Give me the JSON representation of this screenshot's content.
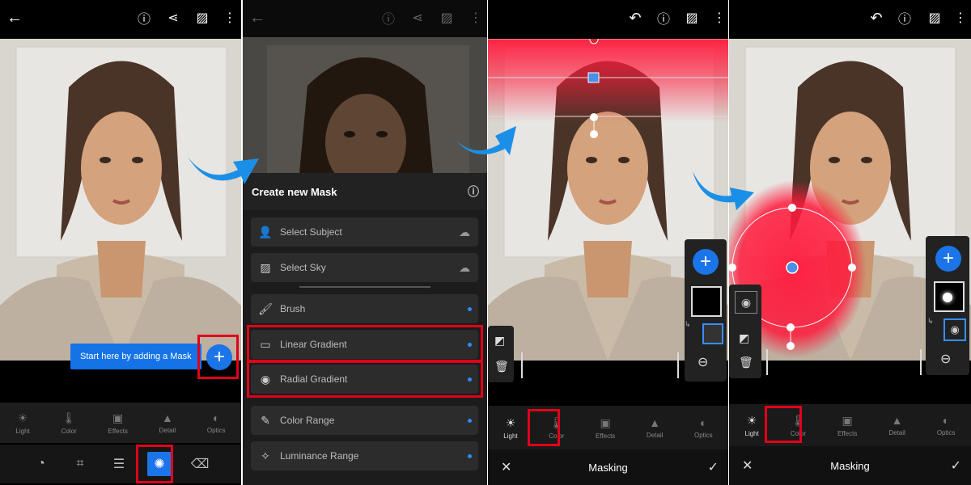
{
  "panel1": {
    "tooltip": "Start here by adding a Mask",
    "tools": [
      {
        "label": "Light",
        "glyph": "☀"
      },
      {
        "label": "Color",
        "glyph": "🌡"
      },
      {
        "label": "Effects",
        "glyph": "▣"
      },
      {
        "label": "Detail",
        "glyph": "▲"
      },
      {
        "label": "Optics",
        "glyph": "◐"
      }
    ]
  },
  "panel2": {
    "menu_title": "Create new Mask",
    "items": [
      {
        "label": "Select Subject",
        "icon": "person-icon",
        "glyph": "👤"
      },
      {
        "label": "Select Sky",
        "icon": "sky-icon",
        "glyph": "▨"
      },
      {
        "label": "Brush",
        "icon": "brush-icon",
        "glyph": "🖌"
      },
      {
        "label": "Linear Gradient",
        "icon": "linear-gradient-icon",
        "glyph": "▭"
      },
      {
        "label": "Radial Gradient",
        "icon": "radial-gradient-icon",
        "glyph": "◉"
      },
      {
        "label": "Color Range",
        "icon": "color-range-icon",
        "glyph": "✎"
      },
      {
        "label": "Luminance Range",
        "icon": "luminance-range-icon",
        "glyph": "✧"
      }
    ]
  },
  "panel3": {
    "tools": [
      {
        "label": "Light",
        "glyph": "☀"
      },
      {
        "label": "Color",
        "glyph": "🌡"
      },
      {
        "label": "Effects",
        "glyph": "▣"
      },
      {
        "label": "Detail",
        "glyph": "▲"
      },
      {
        "label": "Optics",
        "glyph": "◐"
      }
    ],
    "bottom_title": "Masking"
  },
  "panel4": {
    "tools": [
      {
        "label": "Light",
        "glyph": "☀"
      },
      {
        "label": "Color",
        "glyph": "🌡"
      },
      {
        "label": "Effects",
        "glyph": "▣"
      },
      {
        "label": "Detail",
        "glyph": "▲"
      },
      {
        "label": "Optics",
        "glyph": "◐"
      }
    ],
    "bottom_title": "Masking"
  },
  "colors": {
    "accent_blue": "#1b74e8",
    "highlight_red": "#e2001a",
    "mask_overlay": "#ff1a3c"
  }
}
